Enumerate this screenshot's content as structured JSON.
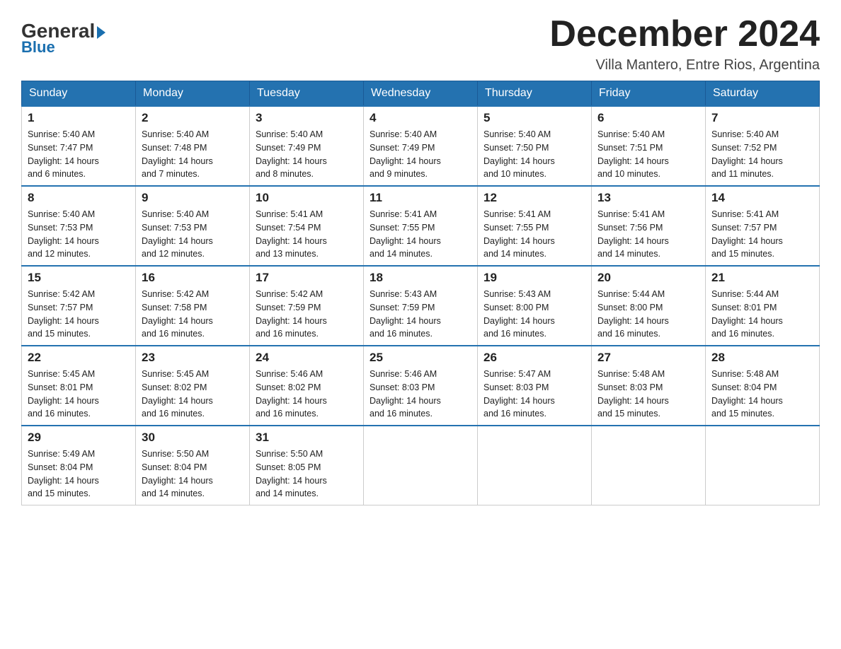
{
  "header": {
    "logo_general": "General",
    "logo_blue": "Blue",
    "month_year": "December 2024",
    "location": "Villa Mantero, Entre Rios, Argentina"
  },
  "days_of_week": [
    "Sunday",
    "Monday",
    "Tuesday",
    "Wednesday",
    "Thursday",
    "Friday",
    "Saturday"
  ],
  "weeks": [
    [
      {
        "day": "1",
        "sunrise": "5:40 AM",
        "sunset": "7:47 PM",
        "daylight": "14 hours and 6 minutes."
      },
      {
        "day": "2",
        "sunrise": "5:40 AM",
        "sunset": "7:48 PM",
        "daylight": "14 hours and 7 minutes."
      },
      {
        "day": "3",
        "sunrise": "5:40 AM",
        "sunset": "7:49 PM",
        "daylight": "14 hours and 8 minutes."
      },
      {
        "day": "4",
        "sunrise": "5:40 AM",
        "sunset": "7:49 PM",
        "daylight": "14 hours and 9 minutes."
      },
      {
        "day": "5",
        "sunrise": "5:40 AM",
        "sunset": "7:50 PM",
        "daylight": "14 hours and 10 minutes."
      },
      {
        "day": "6",
        "sunrise": "5:40 AM",
        "sunset": "7:51 PM",
        "daylight": "14 hours and 10 minutes."
      },
      {
        "day": "7",
        "sunrise": "5:40 AM",
        "sunset": "7:52 PM",
        "daylight": "14 hours and 11 minutes."
      }
    ],
    [
      {
        "day": "8",
        "sunrise": "5:40 AM",
        "sunset": "7:53 PM",
        "daylight": "14 hours and 12 minutes."
      },
      {
        "day": "9",
        "sunrise": "5:40 AM",
        "sunset": "7:53 PM",
        "daylight": "14 hours and 12 minutes."
      },
      {
        "day": "10",
        "sunrise": "5:41 AM",
        "sunset": "7:54 PM",
        "daylight": "14 hours and 13 minutes."
      },
      {
        "day": "11",
        "sunrise": "5:41 AM",
        "sunset": "7:55 PM",
        "daylight": "14 hours and 14 minutes."
      },
      {
        "day": "12",
        "sunrise": "5:41 AM",
        "sunset": "7:55 PM",
        "daylight": "14 hours and 14 minutes."
      },
      {
        "day": "13",
        "sunrise": "5:41 AM",
        "sunset": "7:56 PM",
        "daylight": "14 hours and 14 minutes."
      },
      {
        "day": "14",
        "sunrise": "5:41 AM",
        "sunset": "7:57 PM",
        "daylight": "14 hours and 15 minutes."
      }
    ],
    [
      {
        "day": "15",
        "sunrise": "5:42 AM",
        "sunset": "7:57 PM",
        "daylight": "14 hours and 15 minutes."
      },
      {
        "day": "16",
        "sunrise": "5:42 AM",
        "sunset": "7:58 PM",
        "daylight": "14 hours and 16 minutes."
      },
      {
        "day": "17",
        "sunrise": "5:42 AM",
        "sunset": "7:59 PM",
        "daylight": "14 hours and 16 minutes."
      },
      {
        "day": "18",
        "sunrise": "5:43 AM",
        "sunset": "7:59 PM",
        "daylight": "14 hours and 16 minutes."
      },
      {
        "day": "19",
        "sunrise": "5:43 AM",
        "sunset": "8:00 PM",
        "daylight": "14 hours and 16 minutes."
      },
      {
        "day": "20",
        "sunrise": "5:44 AM",
        "sunset": "8:00 PM",
        "daylight": "14 hours and 16 minutes."
      },
      {
        "day": "21",
        "sunrise": "5:44 AM",
        "sunset": "8:01 PM",
        "daylight": "14 hours and 16 minutes."
      }
    ],
    [
      {
        "day": "22",
        "sunrise": "5:45 AM",
        "sunset": "8:01 PM",
        "daylight": "14 hours and 16 minutes."
      },
      {
        "day": "23",
        "sunrise": "5:45 AM",
        "sunset": "8:02 PM",
        "daylight": "14 hours and 16 minutes."
      },
      {
        "day": "24",
        "sunrise": "5:46 AM",
        "sunset": "8:02 PM",
        "daylight": "14 hours and 16 minutes."
      },
      {
        "day": "25",
        "sunrise": "5:46 AM",
        "sunset": "8:03 PM",
        "daylight": "14 hours and 16 minutes."
      },
      {
        "day": "26",
        "sunrise": "5:47 AM",
        "sunset": "8:03 PM",
        "daylight": "14 hours and 16 minutes."
      },
      {
        "day": "27",
        "sunrise": "5:48 AM",
        "sunset": "8:03 PM",
        "daylight": "14 hours and 15 minutes."
      },
      {
        "day": "28",
        "sunrise": "5:48 AM",
        "sunset": "8:04 PM",
        "daylight": "14 hours and 15 minutes."
      }
    ],
    [
      {
        "day": "29",
        "sunrise": "5:49 AM",
        "sunset": "8:04 PM",
        "daylight": "14 hours and 15 minutes."
      },
      {
        "day": "30",
        "sunrise": "5:50 AM",
        "sunset": "8:04 PM",
        "daylight": "14 hours and 14 minutes."
      },
      {
        "day": "31",
        "sunrise": "5:50 AM",
        "sunset": "8:05 PM",
        "daylight": "14 hours and 14 minutes."
      },
      null,
      null,
      null,
      null
    ]
  ],
  "labels": {
    "sunrise": "Sunrise:",
    "sunset": "Sunset:",
    "daylight": "Daylight:"
  }
}
